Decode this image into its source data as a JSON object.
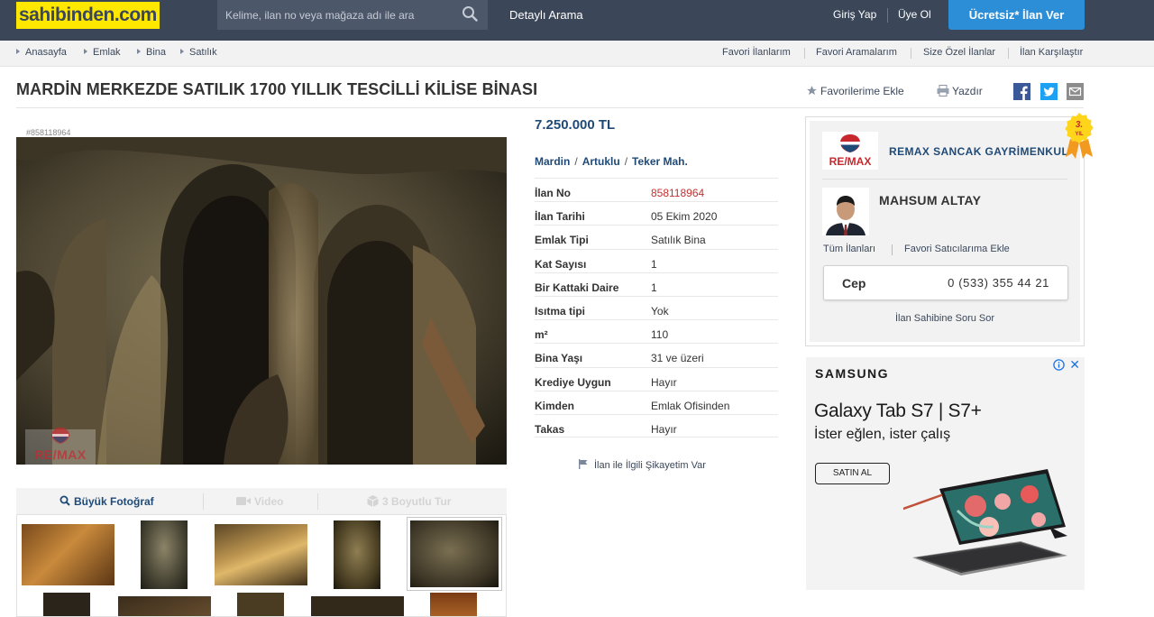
{
  "header": {
    "logo": "sahibinden.com",
    "search_placeholder": "Kelime, ilan no veya mağaza adı ile ara",
    "detailed_search": "Detaylı Arama",
    "login": "Giriş Yap",
    "register": "Üye Ol",
    "post_ad": "Ücretsiz* İlan Ver"
  },
  "breadcrumb": [
    "Anasayfa",
    "Emlak",
    "Bina",
    "Satılık"
  ],
  "toplinks": [
    "Favori İlanlarım",
    "Favori Aramalarım",
    "Size Özel İlanlar",
    "İlan Karşılaştır"
  ],
  "listing": {
    "title": "MARDİN MERKEZDE SATILIK 1700 YILLIK TESCİLLİ KİLİSE BİNASI",
    "add_favorite": "Favorilerime Ekle",
    "print": "Yazdır",
    "id_label": "#858118964",
    "watermark": "RE/MAX",
    "price": "7.250.000 TL",
    "location": [
      "Mardin",
      "Artuklu",
      "Teker Mah."
    ],
    "details": [
      {
        "key": "İlan No",
        "value": "858118964"
      },
      {
        "key": "İlan Tarihi",
        "value": "05 Ekim 2020"
      },
      {
        "key": "Emlak Tipi",
        "value": "Satılık Bina"
      },
      {
        "key": "Kat Sayısı",
        "value": "1"
      },
      {
        "key": "Bir Kattaki Daire",
        "value": "1"
      },
      {
        "key": "Isıtma tipi",
        "value": "Yok"
      },
      {
        "key": "m²",
        "value": "110"
      },
      {
        "key": "Bina Yaşı",
        "value": "31 ve üzeri"
      },
      {
        "key": "Krediye Uygun",
        "value": "Hayır"
      },
      {
        "key": "Kimden",
        "value": "Emlak Ofisinden"
      },
      {
        "key": "Takas",
        "value": "Hayır"
      }
    ],
    "complaint": "İlan ile İlgili Şikayetim Var",
    "photo_tabs": [
      "Büyük Fotoğraf",
      "Video",
      "3 Boyutlu Tur"
    ]
  },
  "seller": {
    "firm": "REMAX SANCAK GAYRİMENKUL",
    "logo_text": "RE/MAX",
    "badge": "3. YIL",
    "agent": "MAHSUM ALTAY",
    "all_listings": "Tüm İlanları",
    "add_fav_seller": "Favori Satıcılarıma Ekle",
    "phone_label": "Cep",
    "phone": "0 (533) 355 44 21",
    "ask": "İlan Sahibine Soru Sor"
  },
  "ad": {
    "brand": "SAMSUNG",
    "product": "Galaxy Tab S7 | S7+",
    "tagline": "İster eğlen, ister çalış",
    "cta": "SATIN AL"
  },
  "colors": {
    "header": "#3b4759",
    "logo_bg": "#ffe800",
    "cta": "#2d8ed8",
    "price": "#1f4a78",
    "id_red": "#c3302f"
  }
}
